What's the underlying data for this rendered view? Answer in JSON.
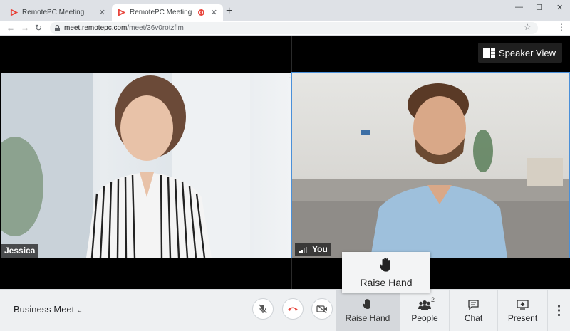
{
  "browser": {
    "tabs": [
      {
        "label": "RemotePC Meeting",
        "active": false
      },
      {
        "label": "RemotePC Meeting",
        "active": true
      }
    ],
    "url_domain": "meet.remotepc.com",
    "url_path": "/meet/36v0rotzflm"
  },
  "speaker_view": {
    "label": "Speaker View"
  },
  "participants": [
    {
      "name": "Jessica"
    },
    {
      "name": "You"
    }
  ],
  "popup": {
    "label": "Raise Hand"
  },
  "toolbar": {
    "meeting_name": "Business Meet",
    "raise_hand": "Raise Hand",
    "people": "People",
    "people_count": "2",
    "chat": "Chat",
    "present": "Present"
  },
  "colors": {
    "accent_red": "#e8453c",
    "active_border": "#4a90d9"
  }
}
